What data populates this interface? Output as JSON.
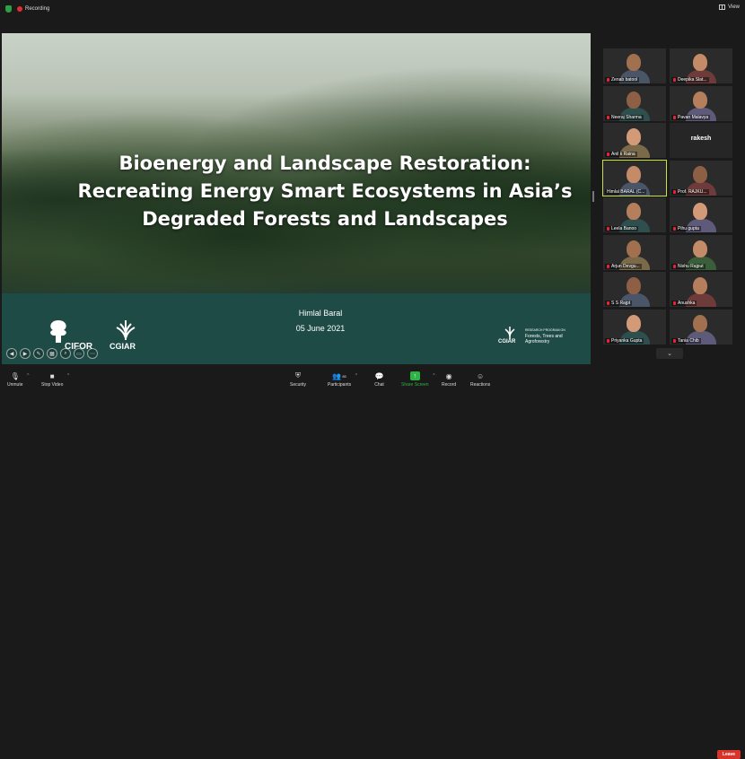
{
  "topbar": {
    "recording_label": "Recording",
    "view_label": "View"
  },
  "slide": {
    "title_line1": "Bioenergy and Landscape Restoration:",
    "title_line2": "Recreating Energy Smart Ecosystems in Asia’s",
    "title_line3": "Degraded Forests and Landscapes",
    "author": "Himlal Baral",
    "date": "05 June 2021",
    "logo_cifor": "CIFOR",
    "logo_cgiar": "CGIAR",
    "logo_ftai_c": "CGIAR",
    "logo_ftai_l1": "RESEARCH PROGRAM ON",
    "logo_ftai_l2": "Forests, Trees and",
    "logo_ftai_l3": "Agroforestry"
  },
  "participants": [
    {
      "name": "Zenab batool",
      "muted": true,
      "video": true
    },
    {
      "name": "Deepika Slat...",
      "muted": true,
      "video": true
    },
    {
      "name": "Neeraj Sharma",
      "muted": true,
      "video": true
    },
    {
      "name": "Pavan Malavya",
      "muted": true,
      "video": true
    },
    {
      "name": "Anil k Raina",
      "muted": true,
      "video": true
    },
    {
      "name": "rakesh",
      "muted": true,
      "video": false
    },
    {
      "name": "Himlal BARAL (C...",
      "muted": false,
      "video": true,
      "active": true
    },
    {
      "name": "Prof. RAJKU...",
      "muted": true,
      "video": true
    },
    {
      "name": "Leela Banoo",
      "muted": true,
      "video": true
    },
    {
      "name": "Pihu gupta",
      "muted": true,
      "video": true
    },
    {
      "name": "Arjun Devgu...",
      "muted": true,
      "video": true
    },
    {
      "name": "Nishu Rajput",
      "muted": true,
      "video": true
    },
    {
      "name": "S S Rajpt",
      "muted": true,
      "video": true
    },
    {
      "name": "Anushka",
      "muted": true,
      "video": true
    },
    {
      "name": "Priyanka Gupta",
      "muted": true,
      "video": true
    },
    {
      "name": "Tania Chib",
      "muted": true,
      "video": true
    }
  ],
  "toolbar": {
    "unmute": "Unmute",
    "stop_video": "Stop Video",
    "security": "Security",
    "participants": "Participants",
    "participants_count": "85",
    "chat": "Chat",
    "share_screen": "Share Screen",
    "record": "Record",
    "reactions": "Reactions",
    "leave": "Leave"
  },
  "colors": {
    "accent_green": "#2fb344",
    "leave_red": "#d9342b",
    "active_outline": "#c6e33b"
  }
}
